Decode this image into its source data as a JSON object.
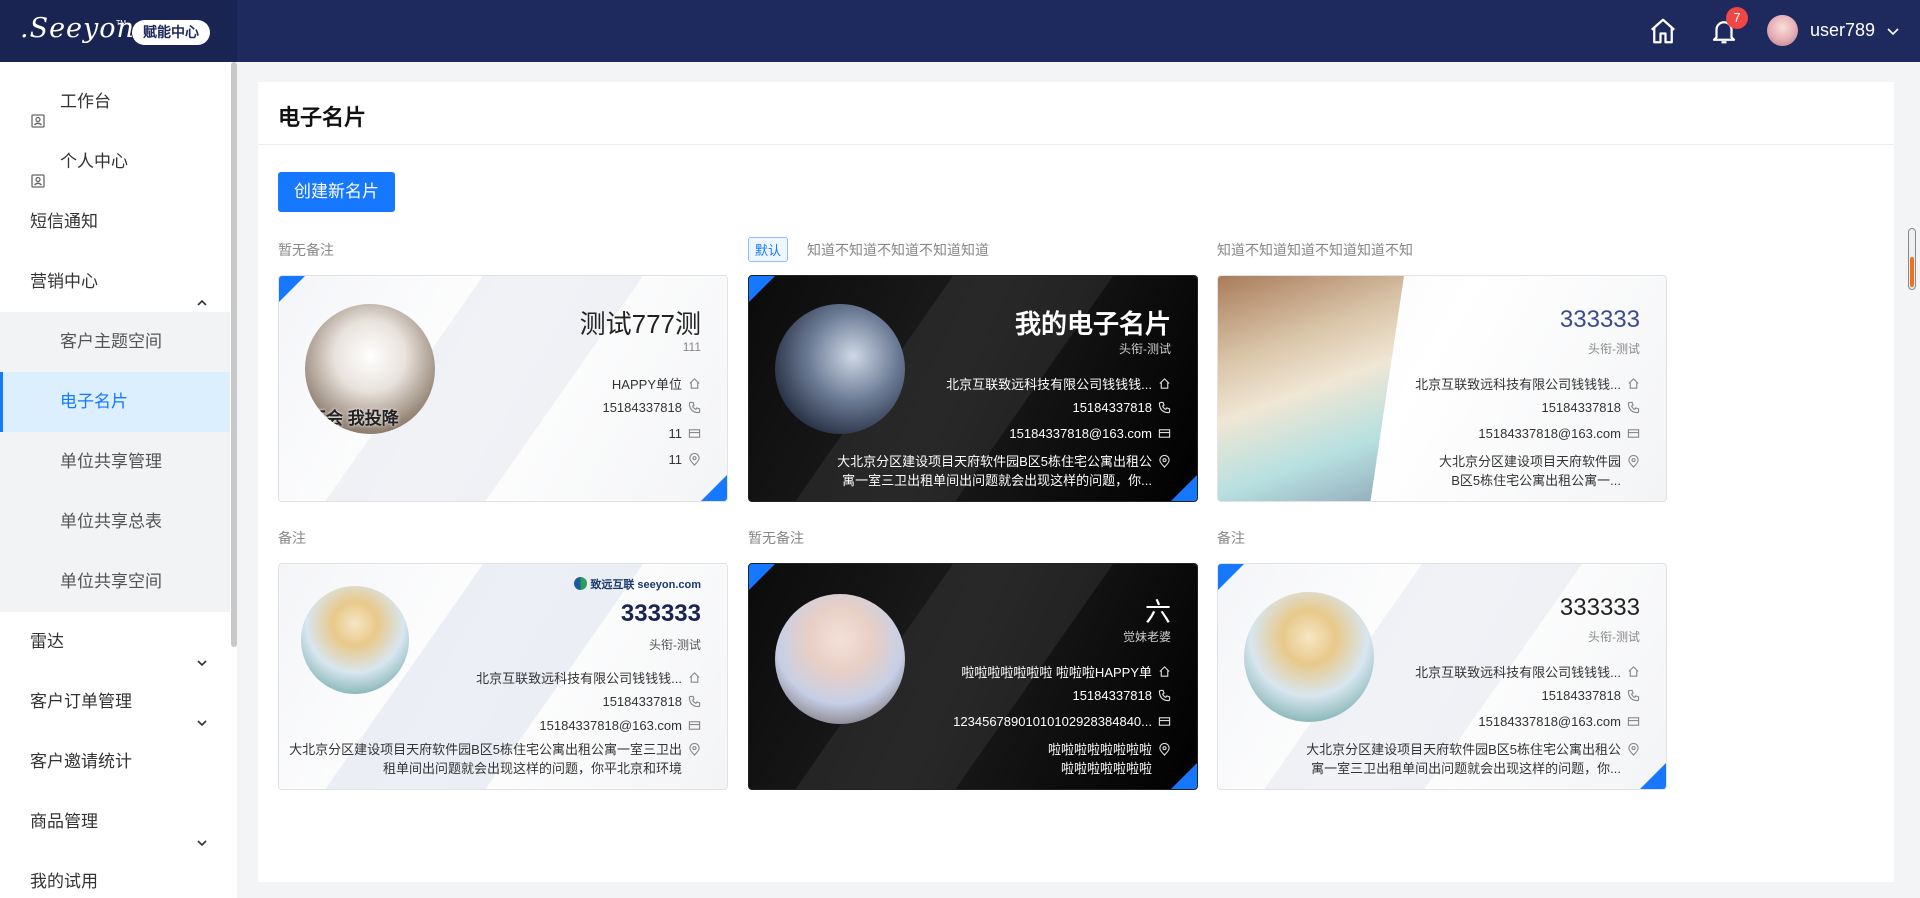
{
  "header": {
    "logo_text": ".Seeyon",
    "logo_tm": "TM",
    "badge": "赋能中心",
    "notification_count": "7",
    "username": "user789"
  },
  "sidebar": {
    "items": [
      {
        "label": "工作台"
      },
      {
        "label": "个人中心"
      },
      {
        "label": "短信通知"
      },
      {
        "label": "营销中心"
      },
      {
        "label": "雷达"
      },
      {
        "label": "客户订单管理"
      },
      {
        "label": "客户邀请统计"
      },
      {
        "label": "商品管理"
      },
      {
        "label": "我的试用"
      }
    ],
    "sub_items": [
      {
        "label": "客户主题空间"
      },
      {
        "label": "电子名片"
      },
      {
        "label": "单位共享管理"
      },
      {
        "label": "单位共享总表"
      },
      {
        "label": "单位共享空间"
      }
    ]
  },
  "main": {
    "title": "电子名片",
    "create_button": "创建新名片",
    "cards": [
      {
        "note": "暂无备注",
        "name": "测试777测",
        "subtitle": "111",
        "line1": "HAPPY单位",
        "phone": "15184337818",
        "email": "11",
        "address": "11",
        "photo_caption": "不会 我投降"
      },
      {
        "default_tag": "默认",
        "note": "知道不知道不知道不知道知道",
        "name": "我的电子名片",
        "subtitle": "头衔-测试",
        "line1": "北京互联致远科技有限公司钱钱钱...",
        "phone": "15184337818",
        "email": "15184337818@163.com",
        "address": "大北京分区建设项目天府软件园B区5栋住宅公寓出租公寓一室三卫出租单间出问题就会出现这样的问题，你..."
      },
      {
        "note": "知道不知道知道不知道知道不知",
        "name": "333333",
        "subtitle": "头衔-测试",
        "line1": "北京互联致远科技有限公司钱钱钱...",
        "phone": "15184337818",
        "email": "15184337818@163.com",
        "address": "大北京分区建设项目天府软件园B区5栋住宅公寓出租公寓一..."
      },
      {
        "note": "备注",
        "brand": "致远互联 seeyon.com",
        "name": "333333",
        "subtitle": "头衔-测试",
        "line1": "北京互联致远科技有限公司钱钱钱...",
        "phone": "15184337818",
        "email": "15184337818@163.com",
        "address": "大北京分区建设项目天府软件园B区5栋住宅公寓出租公寓一室三卫出租单间出问题就会出现这样的问题，你平北京和环境"
      },
      {
        "note": "暂无备注",
        "name": "六",
        "subtitle": "觉妹老婆",
        "line1": "啦啦啦啦啦啦啦 啦啦啦HAPPY单",
        "phone": "15184337818",
        "email": "12345678901010102928384840...",
        "address": "啦啦啦啦啦啦啦啦 啦啦啦啦啦啦啦"
      },
      {
        "note": "备注",
        "name": "333333",
        "subtitle": "头衔-测试",
        "line1": "北京互联致远科技有限公司钱钱钱...",
        "phone": "15184337818",
        "email": "15184337818@163.com",
        "address": "大北京分区建设项目天府软件园B区5栋住宅公寓出租公寓一室三卫出租单间出问题就会出现这样的问题，你..."
      }
    ]
  },
  "colors": {
    "header_bg": "#1e2a5e",
    "accent": "#1677ff",
    "badge_red": "#f04646"
  }
}
